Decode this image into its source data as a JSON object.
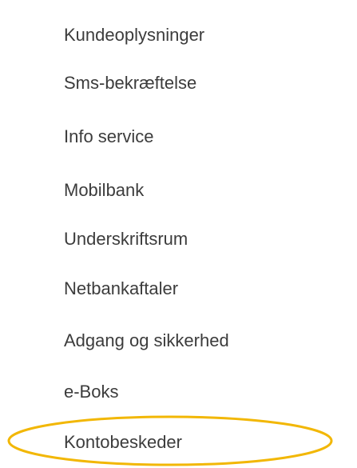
{
  "menu": {
    "items": [
      {
        "label": "Kundeoplysninger"
      },
      {
        "label": "Sms-bekræftelse"
      },
      {
        "label": "Info service"
      },
      {
        "label": "Mobilbank"
      },
      {
        "label": "Underskriftsrum"
      },
      {
        "label": "Netbankaftaler"
      },
      {
        "label": "Adgang og sikkerhed"
      },
      {
        "label": "e-Boks"
      },
      {
        "label": "Kontobeskeder"
      }
    ]
  },
  "annotation": {
    "shape": "ellipse",
    "color": "#f2b705",
    "target": "Kontobeskeder"
  }
}
